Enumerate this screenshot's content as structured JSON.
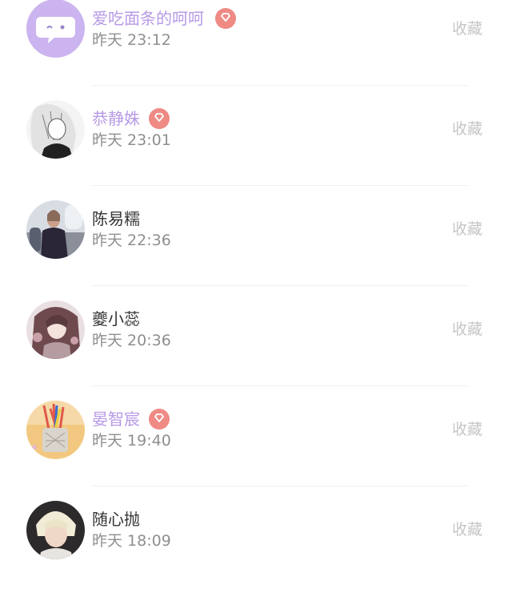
{
  "colors": {
    "vip_name": "#b79ae6",
    "plain_name": "#333333",
    "time_text": "#8f8f8f",
    "favorite_text": "#c6c6c6",
    "vip_badge": "#ef8a84",
    "chat_avatar_bg": "#cbb4ef"
  },
  "users": [
    {
      "name": "爱吃面条的呵呵",
      "time": "昨天 23:12",
      "vip": true,
      "avatar": "chat-bubble-icon",
      "favorite": "收藏"
    },
    {
      "name": "恭静姝",
      "time": "昨天 23:01",
      "vip": true,
      "avatar": "manga-portrait",
      "favorite": "收藏"
    },
    {
      "name": "陈易糯",
      "time": "昨天 22:36",
      "vip": false,
      "avatar": "seated-person-photo",
      "favorite": "收藏"
    },
    {
      "name": "夔小蕊",
      "time": "昨天 20:36",
      "vip": false,
      "avatar": "anime-girl-portrait",
      "favorite": "收藏"
    },
    {
      "name": "晏智宸",
      "time": "昨天 19:40",
      "vip": true,
      "avatar": "pencil-cup-photo",
      "favorite": "收藏"
    },
    {
      "name": "随心抛",
      "time": "昨天 18:09",
      "vip": false,
      "avatar": "blonde-person-photo",
      "favorite": "收藏"
    }
  ]
}
